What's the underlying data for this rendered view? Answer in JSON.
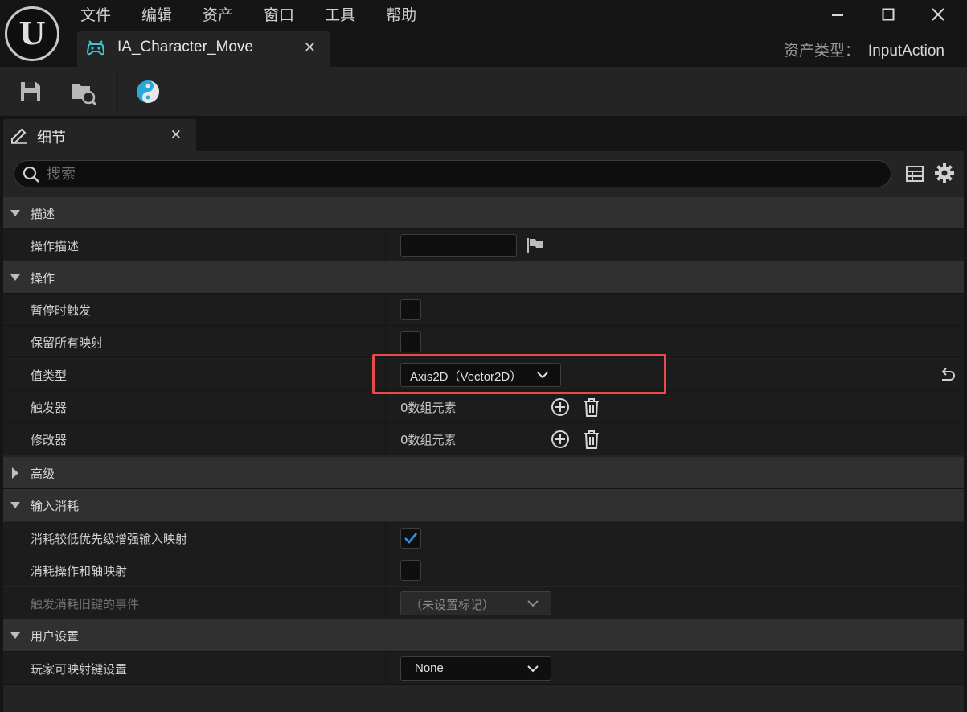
{
  "menu": [
    "文件",
    "编辑",
    "资产",
    "窗口",
    "工具",
    "帮助"
  ],
  "window_controls": {
    "minimize": "—",
    "maximize": "☐",
    "close": "✕"
  },
  "asset_tab": {
    "title": "IA_Character_Move",
    "close": "✕"
  },
  "asset_type": {
    "label": "资产类型：",
    "value": "InputAction"
  },
  "details_tab": {
    "label": "细节",
    "close": "✕"
  },
  "search": {
    "placeholder": "搜索"
  },
  "categories": {
    "describe": "描述",
    "action": "操作",
    "advanced": "高级",
    "input_consume": "输入消耗",
    "user_settings": "用户设置"
  },
  "properties": {
    "action_description": {
      "label": "操作描述",
      "value": ""
    },
    "trigger_when_paused": {
      "label": "暂停时触发",
      "checked": false
    },
    "reserve_all_mappings": {
      "label": "保留所有映射",
      "checked": false
    },
    "value_type": {
      "label": "值类型",
      "value": "Axis2D（Vector2D）"
    },
    "triggers": {
      "label": "触发器",
      "value": "0数组元素"
    },
    "modifiers": {
      "label": "修改器",
      "value": "0数组元素"
    },
    "consume_lower_priority": {
      "label": "消耗较低优先级增强输入映射",
      "checked": true
    },
    "consume_action_axis": {
      "label": "消耗操作和轴映射",
      "checked": false
    },
    "trigger_consume_legacy": {
      "label": "触发消耗旧键的事件",
      "value": "（未设置标记）"
    },
    "player_mappable_settings": {
      "label": "玩家可映射键设置",
      "value": "None"
    }
  },
  "colors": {
    "accent_check": "#3b8fe8",
    "highlight": "#e84a4a",
    "panel": "#242424",
    "row": "#1c1c1c",
    "category": "#303030"
  }
}
